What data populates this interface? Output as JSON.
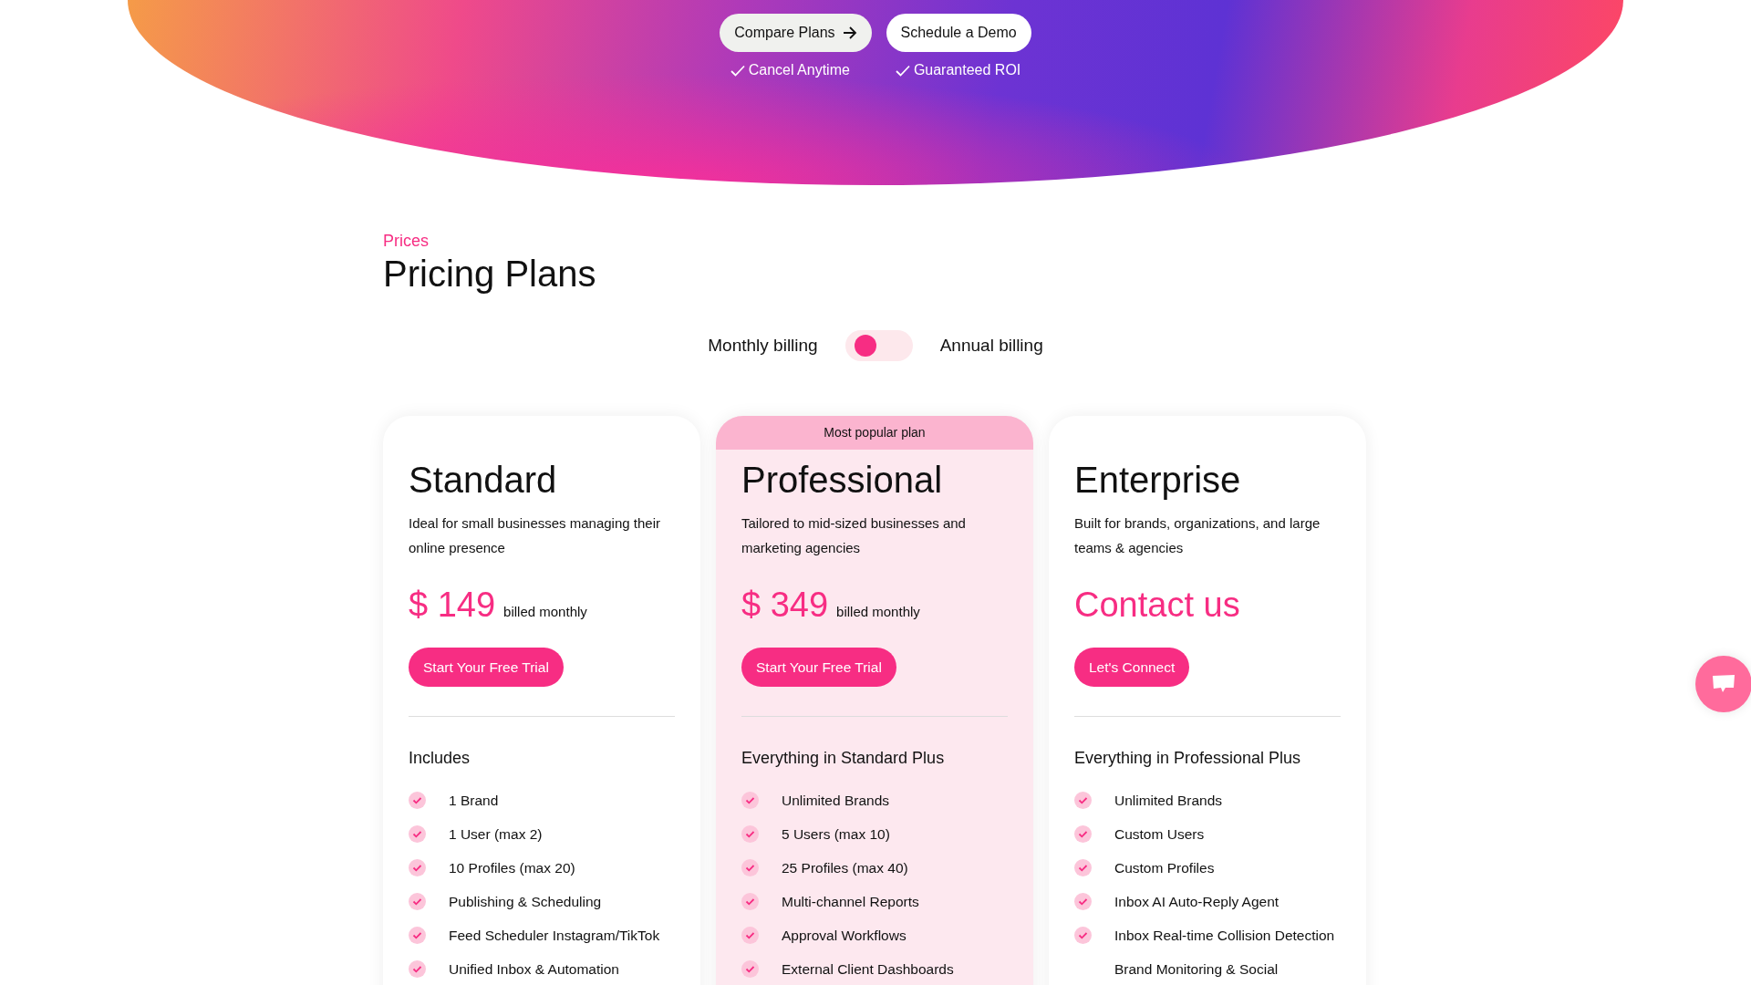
{
  "hero": {
    "buttons": [
      {
        "label": "Compare Plans",
        "kind": "arrow"
      },
      {
        "label": "Schedule a Demo",
        "kind": "plain"
      }
    ],
    "guarantees": [
      "Cancel Anytime",
      "Guaranteed ROI"
    ]
  },
  "section": {
    "eyebrow": "Prices",
    "title": "Pricing Plans"
  },
  "billing": {
    "left": "Monthly billing",
    "right": "Annual billing",
    "on": false
  },
  "plans": [
    {
      "name": "Standard",
      "highlighted": false,
      "description": "Ideal for small businesses managing their online presence",
      "price": "$ 149",
      "period": "billed monthly",
      "cta": "Start Your Free Trial",
      "features_title": "Includes",
      "features": [
        {
          "text": "1 Brand",
          "checked": true
        },
        {
          "text": "1 User (max 2)",
          "checked": true
        },
        {
          "text": "10 Profiles (max 20)",
          "checked": true
        },
        {
          "text": "Publishing & Scheduling",
          "checked": true
        },
        {
          "text": "Feed Scheduler Instagram/TikTok",
          "checked": true
        },
        {
          "text": "Unified Inbox & Automation",
          "checked": true
        }
      ]
    },
    {
      "name": "Professional",
      "highlighted": true,
      "badge": "Most popular plan",
      "description": "Tailored to mid-sized businesses and marketing agencies",
      "price": "$ 349",
      "period": "billed monthly",
      "cta": "Start Your Free Trial",
      "features_title": "Everything in Standard Plus",
      "features": [
        {
          "text": "Unlimited Brands",
          "checked": true
        },
        {
          "text": "5 Users (max 10)",
          "checked": true
        },
        {
          "text": "25 Profiles (max 40)",
          "checked": true
        },
        {
          "text": "Multi-channel Reports",
          "checked": true
        },
        {
          "text": "Approval Workflows",
          "checked": true
        },
        {
          "text": "External Client Dashboards",
          "checked": true
        }
      ]
    },
    {
      "name": "Enterprise",
      "highlighted": false,
      "description": "Built for brands, organizations, and large teams & agencies",
      "price": "Contact us",
      "cta": "Let's Connect",
      "features_title": "Everything in Professional Plus",
      "features": [
        {
          "text": "Unlimited Brands",
          "checked": true
        },
        {
          "text": "Custom Users",
          "checked": true
        },
        {
          "text": "Custom Profiles",
          "checked": true
        },
        {
          "text": "Inbox AI Auto-Reply Agent",
          "checked": true
        },
        {
          "text": "Inbox Real-time Collision Detection",
          "checked": true
        },
        {
          "text": "Brand Monitoring & Social",
          "checked": false
        }
      ]
    }
  ]
}
